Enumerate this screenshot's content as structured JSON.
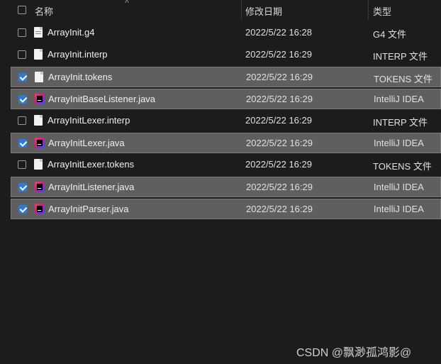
{
  "header": {
    "name": "名称",
    "date": "修改日期",
    "type": "类型"
  },
  "files": [
    {
      "name": "ArrayInit.g4",
      "date": "2022/5/22 16:28",
      "type": "G4 文件",
      "icon": "document-icon",
      "selected": false
    },
    {
      "name": "ArrayInit.interp",
      "date": "2022/5/22 16:29",
      "type": "INTERP 文件",
      "icon": "blank-file-icon",
      "selected": false
    },
    {
      "name": "ArrayInit.tokens",
      "date": "2022/5/22 16:29",
      "type": "TOKENS 文件",
      "icon": "blank-file-icon",
      "selected": true
    },
    {
      "name": "ArrayInitBaseListener.java",
      "date": "2022/5/22 16:29",
      "type": "IntelliJ IDEA",
      "icon": "intellij-idea-icon",
      "selected": true
    },
    {
      "name": "ArrayInitLexer.interp",
      "date": "2022/5/22 16:29",
      "type": "INTERP 文件",
      "icon": "blank-file-icon",
      "selected": false
    },
    {
      "name": "ArrayInitLexer.java",
      "date": "2022/5/22 16:29",
      "type": "IntelliJ IDEA",
      "icon": "intellij-idea-icon",
      "selected": true
    },
    {
      "name": "ArrayInitLexer.tokens",
      "date": "2022/5/22 16:29",
      "type": "TOKENS 文件",
      "icon": "blank-file-icon",
      "selected": false
    },
    {
      "name": "ArrayInitListener.java",
      "date": "2022/5/22 16:29",
      "type": "IntelliJ IDEA",
      "icon": "intellij-idea-icon",
      "selected": true
    },
    {
      "name": "ArrayInitParser.java",
      "date": "2022/5/22 16:29",
      "type": "IntelliJ IDEA",
      "icon": "intellij-idea-icon",
      "selected": true
    }
  ],
  "watermark": "CSDN @飘渺孤鸿影@",
  "colors": {
    "background": "#1c1c1c",
    "selected_row": "#5f5f5f",
    "checkbox_checked": "#2f7ad6"
  }
}
